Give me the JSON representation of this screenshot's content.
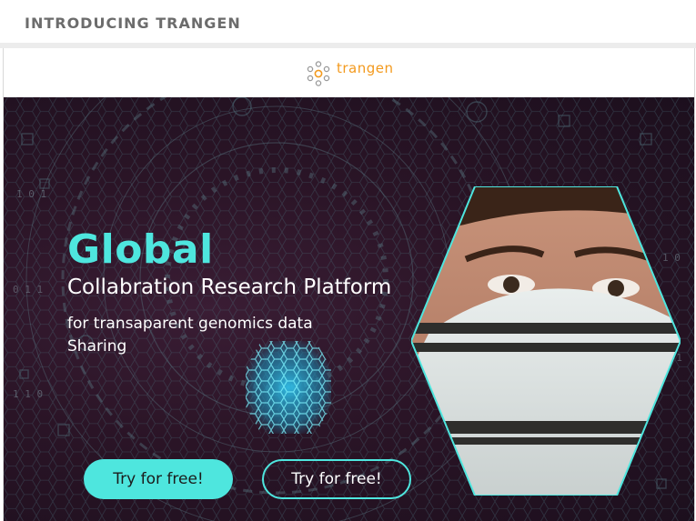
{
  "header": {
    "title": "INTRODUCING TRANGEN"
  },
  "brand": {
    "name": "trangen",
    "logo_icon": "trangen-logo-icon",
    "color": "#f39a1e"
  },
  "banner": {
    "headline": "Global",
    "subheadline": "Collabration Research Platform",
    "tagline_line1": "for transaparent genomics data",
    "tagline_line2": "Sharing",
    "primary_cta": "Try for free!",
    "secondary_cta": "Try for free!",
    "accent_color": "#4ee6de",
    "background_color": "#2a1426",
    "image": "person-wearing-face-mask-behind-bars"
  }
}
